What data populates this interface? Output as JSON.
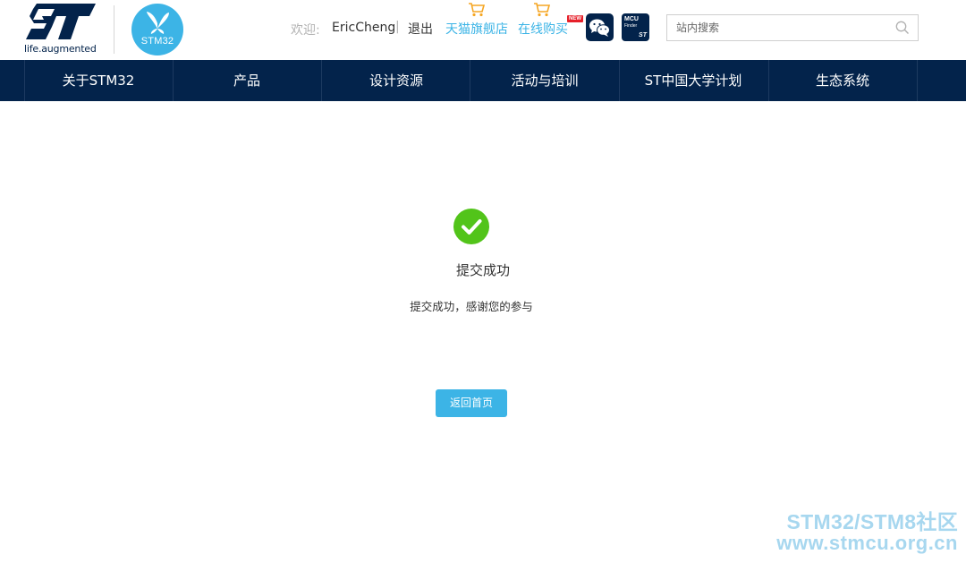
{
  "header": {
    "logo_tagline": "life.augmented",
    "stm32_badge": "STM32",
    "welcome_label": "欢迎:",
    "username": "EricCheng",
    "separator": "|",
    "logout_label": "退出",
    "tmall_link": "天猫旗舰店",
    "online_buy_link": "在线购买",
    "new_badge": "NEW",
    "mcu_finder": {
      "line1": "MCU",
      "line2": "Finder",
      "brand": "ST"
    },
    "search_placeholder": "站内搜索"
  },
  "nav": {
    "items": [
      "关于STM32",
      "产品",
      "设计资源",
      "活动与培训",
      "ST中国大学计划",
      "生态系统"
    ]
  },
  "main": {
    "title": "提交成功",
    "message": "提交成功，感谢您的参与",
    "home_button": "返回首页"
  },
  "watermark": {
    "line1": "STM32/STM8社区",
    "line2": "www.stmcu.org.cn"
  },
  "colors": {
    "brand_navy": "#03234b",
    "brand_cyan": "#3cb4e6",
    "success_green": "#52c41a"
  }
}
